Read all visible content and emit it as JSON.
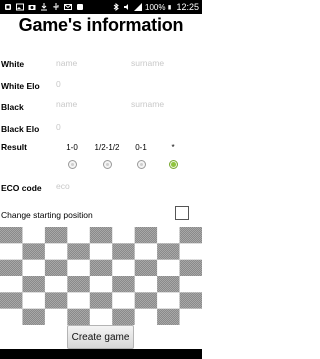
{
  "status_bar": {
    "battery": "100%",
    "time": "12:25"
  },
  "title": "Game's information",
  "white": {
    "label": "White",
    "name_placeholder": "name",
    "surname_placeholder": "surname"
  },
  "white_elo": {
    "label": "White Elo",
    "placeholder": "0"
  },
  "black": {
    "label": "Black",
    "name_placeholder": "name",
    "surname_placeholder": "surname"
  },
  "black_elo": {
    "label": "Black Elo",
    "placeholder": "0"
  },
  "result": {
    "label": "Result",
    "options": [
      {
        "label": "1-0",
        "selected": false
      },
      {
        "label": "1/2-1/2",
        "selected": false
      },
      {
        "label": "0-1",
        "selected": false
      },
      {
        "label": "*",
        "selected": true
      }
    ]
  },
  "eco": {
    "label": "ECO code",
    "placeholder": "eco"
  },
  "starting_position": {
    "label": "Change starting position",
    "checked": false
  },
  "create_button": "Create game",
  "colors": {
    "accent": "#8fc43c"
  }
}
